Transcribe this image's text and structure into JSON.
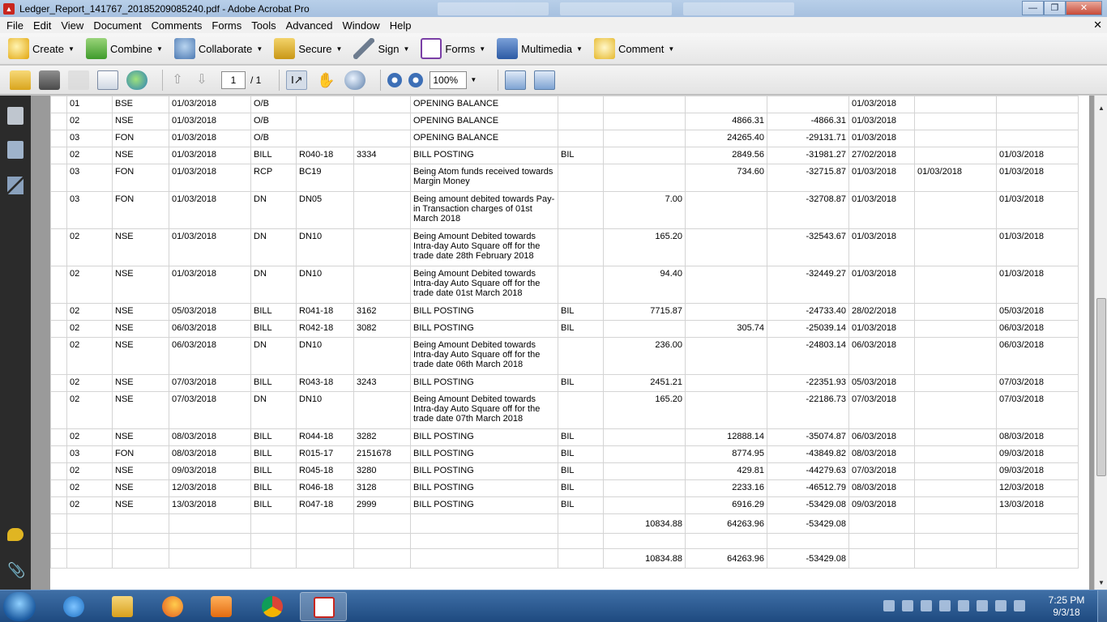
{
  "window": {
    "title": "Ledger_Report_141767_20185209085240.pdf - Adobe Acrobat Pro"
  },
  "menu": [
    "File",
    "Edit",
    "View",
    "Document",
    "Comments",
    "Forms",
    "Tools",
    "Advanced",
    "Window",
    "Help"
  ],
  "tasks": {
    "create": "Create",
    "combine": "Combine",
    "collaborate": "Collaborate",
    "secure": "Secure",
    "sign": "Sign",
    "forms": "Forms",
    "multimedia": "Multimedia",
    "comment": "Comment"
  },
  "toolbar": {
    "page_current": "1",
    "page_total": "/ 1",
    "zoom": "100%"
  },
  "ledger": {
    "rows": [
      [
        "01",
        "BSE",
        "01/03/2018",
        "O/B",
        "",
        "",
        "OPENING BALANCE",
        "",
        "",
        "",
        "",
        "01/03/2018",
        "",
        ""
      ],
      [
        "02",
        "NSE",
        "01/03/2018",
        "O/B",
        "",
        "",
        "OPENING BALANCE",
        "",
        "",
        "4866.31",
        "-4866.31",
        "01/03/2018",
        "",
        ""
      ],
      [
        "03",
        "FON",
        "01/03/2018",
        "O/B",
        "",
        "",
        "OPENING BALANCE",
        "",
        "",
        "24265.40",
        "-29131.71",
        "01/03/2018",
        "",
        ""
      ],
      [
        "02",
        "NSE",
        "01/03/2018",
        "BILL",
        "R040-18",
        "3334",
        "BILL POSTING",
        "BIL",
        "",
        "2849.56",
        "-31981.27",
        "27/02/2018",
        "",
        "01/03/2018"
      ],
      [
        "03",
        "FON",
        "01/03/2018",
        "RCP",
        "BC19",
        "",
        "Being Atom funds received towards Margin Money",
        "",
        "",
        "734.60",
        "-32715.87",
        "01/03/2018",
        "01/03/2018",
        "01/03/2018"
      ],
      [
        "03",
        "FON",
        "01/03/2018",
        "DN",
        "DN05",
        "",
        "Being amount debited towards Pay-in Transaction charges of  01st March 2018",
        "",
        "7.00",
        "",
        "-32708.87",
        "01/03/2018",
        "",
        "01/03/2018"
      ],
      [
        "02",
        "NSE",
        "01/03/2018",
        "DN",
        "DN10",
        "",
        "Being Amount Debited towards Intra-day Auto Square off for the trade date 28th February 2018",
        "",
        "165.20",
        "",
        "-32543.67",
        "01/03/2018",
        "",
        "01/03/2018"
      ],
      [
        "02",
        "NSE",
        "01/03/2018",
        "DN",
        "DN10",
        "",
        "Being Amount Debited towards Intra-day Auto Square off for the trade date 01st March 2018",
        "",
        "94.40",
        "",
        "-32449.27",
        "01/03/2018",
        "",
        "01/03/2018"
      ],
      [
        "02",
        "NSE",
        "05/03/2018",
        "BILL",
        "R041-18",
        "3162",
        "BILL POSTING",
        "BIL",
        "7715.87",
        "",
        "-24733.40",
        "28/02/2018",
        "",
        "05/03/2018"
      ],
      [
        "02",
        "NSE",
        "06/03/2018",
        "BILL",
        "R042-18",
        "3082",
        "BILL POSTING",
        "BIL",
        "",
        "305.74",
        "-25039.14",
        "01/03/2018",
        "",
        "06/03/2018"
      ],
      [
        "02",
        "NSE",
        "06/03/2018",
        "DN",
        "DN10",
        "",
        "Being Amount Debited towards Intra-day Auto Square off for the trade date 06th March 2018",
        "",
        "236.00",
        "",
        "-24803.14",
        "06/03/2018",
        "",
        "06/03/2018"
      ],
      [
        "02",
        "NSE",
        "07/03/2018",
        "BILL",
        "R043-18",
        "3243",
        "BILL POSTING",
        "BIL",
        "2451.21",
        "",
        "-22351.93",
        "05/03/2018",
        "",
        "07/03/2018"
      ],
      [
        "02",
        "NSE",
        "07/03/2018",
        "DN",
        "DN10",
        "",
        "Being Amount Debited towards Intra-day Auto Square off for the trade date 07th March 2018",
        "",
        "165.20",
        "",
        "-22186.73",
        "07/03/2018",
        "",
        "07/03/2018"
      ],
      [
        "02",
        "NSE",
        "08/03/2018",
        "BILL",
        "R044-18",
        "3282",
        "BILL POSTING",
        "BIL",
        "",
        "12888.14",
        "-35074.87",
        "06/03/2018",
        "",
        "08/03/2018"
      ],
      [
        "03",
        "FON",
        "08/03/2018",
        "BILL",
        "R015-17",
        "2151678",
        "BILL POSTING",
        "BIL",
        "",
        "8774.95",
        "-43849.82",
        "08/03/2018",
        "",
        "09/03/2018"
      ],
      [
        "02",
        "NSE",
        "09/03/2018",
        "BILL",
        "R045-18",
        "3280",
        "BILL POSTING",
        "BIL",
        "",
        "429.81",
        "-44279.63",
        "07/03/2018",
        "",
        "09/03/2018"
      ],
      [
        "02",
        "NSE",
        "12/03/2018",
        "BILL",
        "R046-18",
        "3128",
        "BILL POSTING",
        "BIL",
        "",
        "2233.16",
        "-46512.79",
        "08/03/2018",
        "",
        "12/03/2018"
      ],
      [
        "02",
        "NSE",
        "13/03/2018",
        "BILL",
        "R047-18",
        "2999",
        "BILL POSTING",
        "BIL",
        "",
        "6916.29",
        "-53429.08",
        "09/03/2018",
        "",
        "13/03/2018"
      ]
    ],
    "total1": {
      "debit": "10834.88",
      "credit": "64263.96",
      "balance": "-53429.08"
    },
    "total2": {
      "debit": "10834.88",
      "credit": "64263.96",
      "balance": "-53429.08"
    }
  },
  "taskbar": {
    "apps": [
      "internet-explorer",
      "file-explorer",
      "firefox",
      "media-player",
      "chrome",
      "acrobat"
    ],
    "time": "7:25 PM",
    "date": "9/3/18"
  }
}
